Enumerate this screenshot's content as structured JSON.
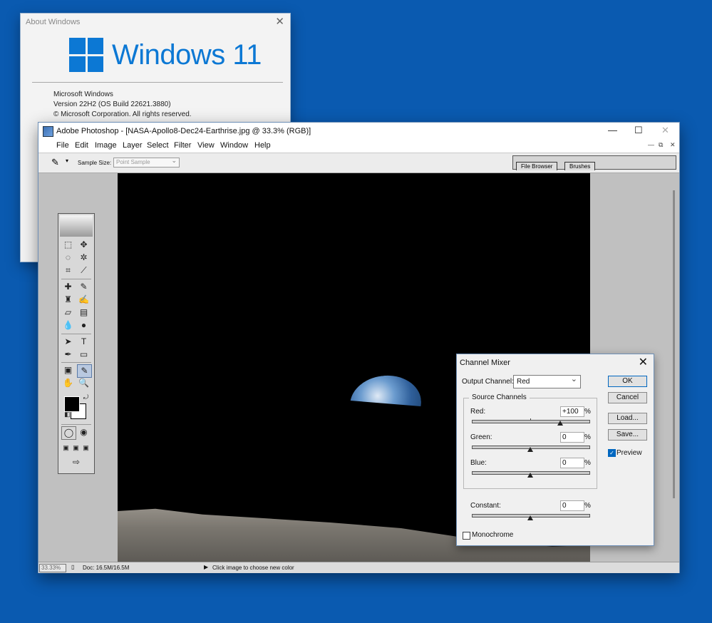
{
  "about": {
    "title": "About Windows",
    "brand": "Windows 11",
    "line1": "Microsoft Windows",
    "line2": "Version 22H2 (OS Build 22621.3880)",
    "line3": "© Microsoft Corporation. All rights reserved."
  },
  "photoshop": {
    "title": "Adobe Photoshop - [NASA-Apollo8-Dec24-Earthrise.jpg @ 33.3% (RGB)]",
    "menu": [
      "File",
      "Edit",
      "Image",
      "Layer",
      "Select",
      "Filter",
      "View",
      "Window",
      "Help"
    ],
    "options": {
      "sample_size_label": "Sample Size:",
      "sample_size_value": "Point Sample"
    },
    "palette_tabs": [
      "File Browser",
      "Brushes"
    ],
    "status": {
      "zoom": "33.33%",
      "doc": "Doc: 16.5M/16.5M",
      "hint": "Click image to choose new color"
    }
  },
  "mixer": {
    "title": "Channel Mixer",
    "output_channel_label": "Output Channel:",
    "output_channel_value": "Red",
    "source_channels_label": "Source Channels",
    "red_label": "Red:",
    "red_value": "+100",
    "green_label": "Green:",
    "green_value": "0",
    "blue_label": "Blue:",
    "blue_value": "0",
    "constant_label": "Constant:",
    "constant_value": "0",
    "percent": "%",
    "monochrome_label": "Monochrome",
    "preview_label": "Preview",
    "buttons": {
      "ok": "OK",
      "cancel": "Cancel",
      "load": "Load...",
      "save": "Save..."
    }
  }
}
